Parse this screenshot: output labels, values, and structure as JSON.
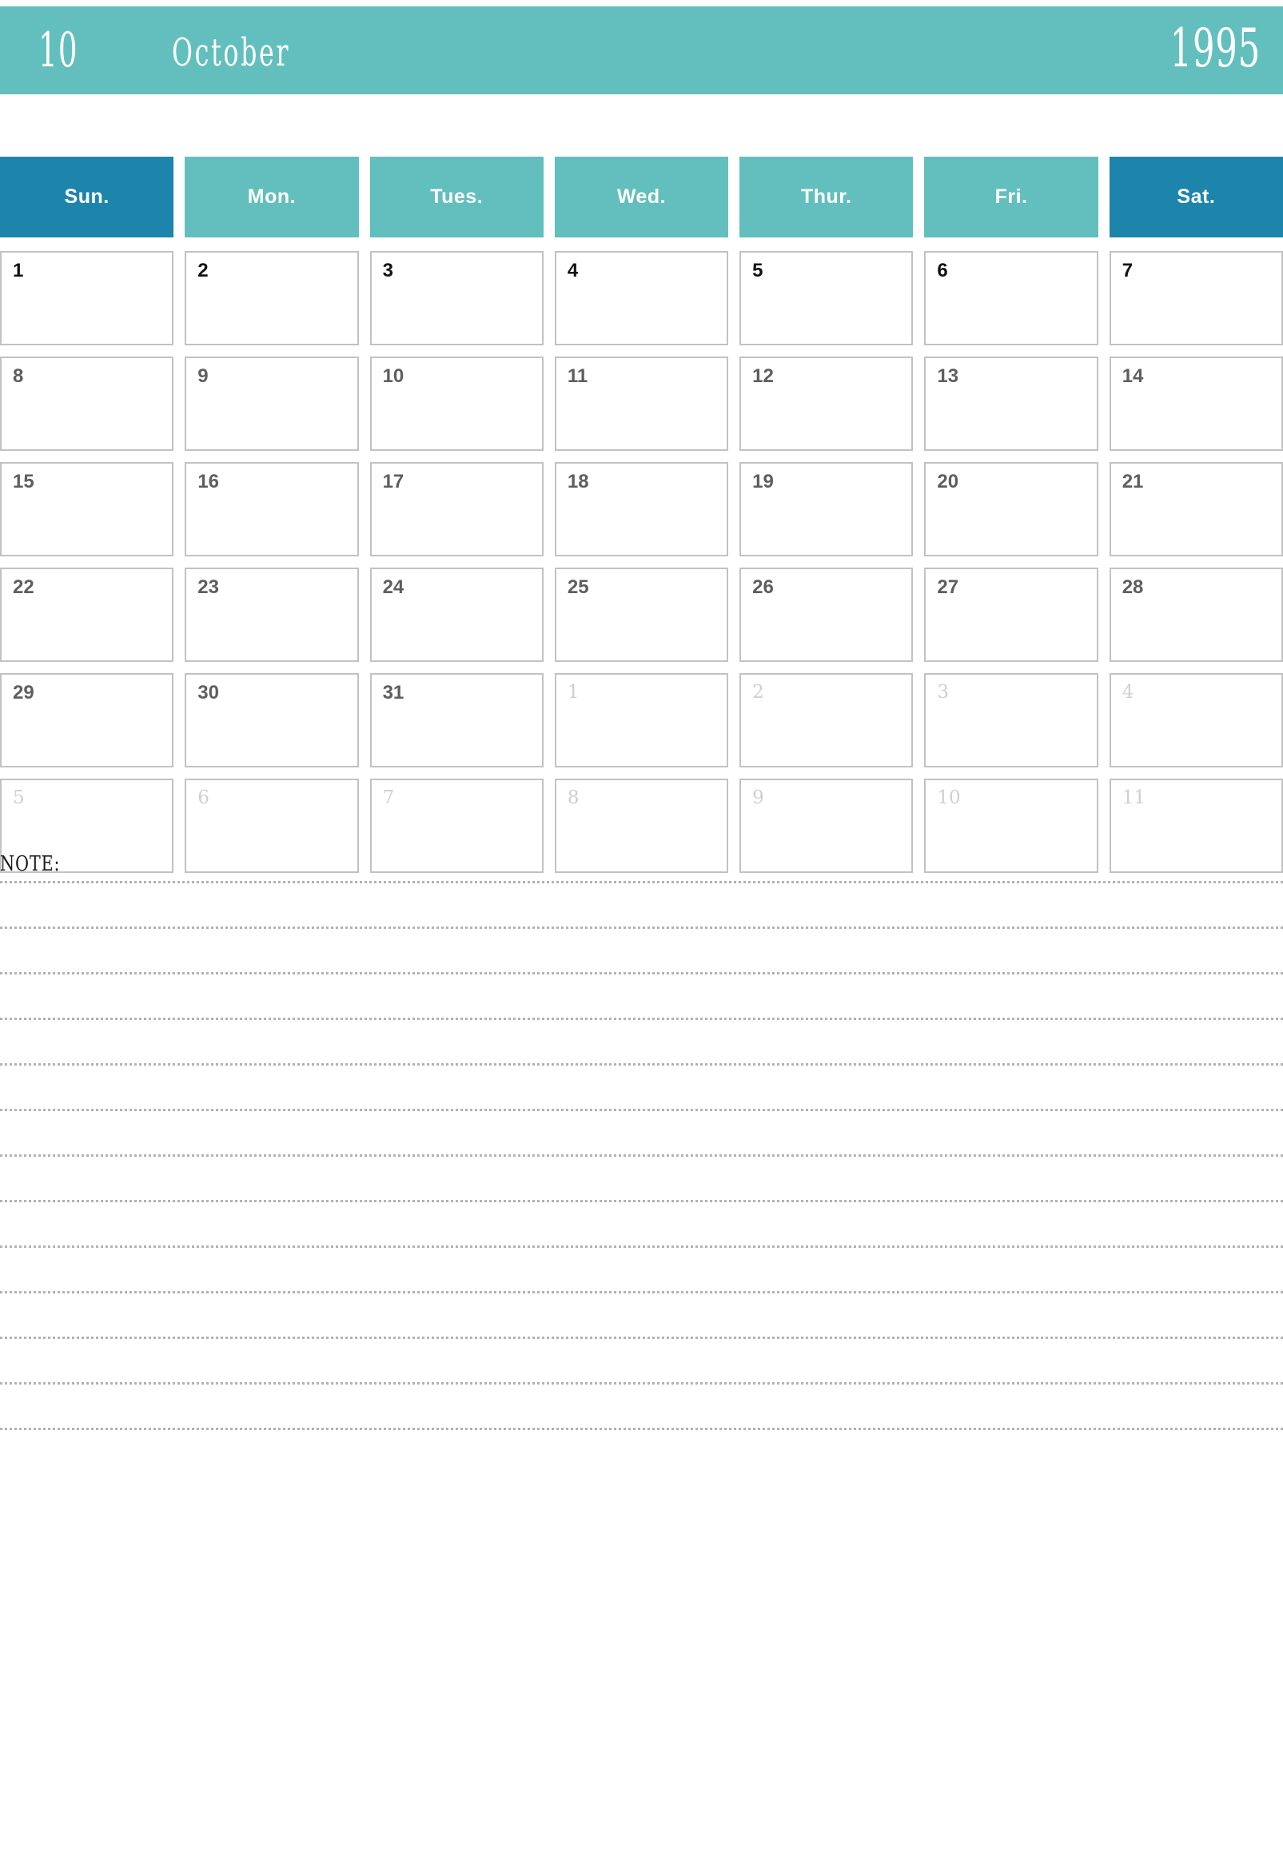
{
  "header": {
    "month_number": "10",
    "month_name": "October",
    "year": "1995",
    "banner_color": "#62bfbd",
    "weekend_color": "#1d85ab",
    "text_color": "#ffffff"
  },
  "weekdays": [
    {
      "label": "Sun.",
      "weekend": true
    },
    {
      "label": "Mon.",
      "weekend": false
    },
    {
      "label": "Tues.",
      "weekend": false
    },
    {
      "label": "Wed.",
      "weekend": false
    },
    {
      "label": "Thur.",
      "weekend": false
    },
    {
      "label": "Fri.",
      "weekend": false
    },
    {
      "label": "Sat.",
      "weekend": true
    }
  ],
  "weeks": [
    [
      {
        "day": "1",
        "other_month": false
      },
      {
        "day": "2",
        "other_month": false
      },
      {
        "day": "3",
        "other_month": false
      },
      {
        "day": "4",
        "other_month": false
      },
      {
        "day": "5",
        "other_month": false
      },
      {
        "day": "6",
        "other_month": false
      },
      {
        "day": "7",
        "other_month": false
      }
    ],
    [
      {
        "day": "8",
        "other_month": false
      },
      {
        "day": "9",
        "other_month": false
      },
      {
        "day": "10",
        "other_month": false
      },
      {
        "day": "11",
        "other_month": false
      },
      {
        "day": "12",
        "other_month": false
      },
      {
        "day": "13",
        "other_month": false
      },
      {
        "day": "14",
        "other_month": false
      }
    ],
    [
      {
        "day": "15",
        "other_month": false
      },
      {
        "day": "16",
        "other_month": false
      },
      {
        "day": "17",
        "other_month": false
      },
      {
        "day": "18",
        "other_month": false
      },
      {
        "day": "19",
        "other_month": false
      },
      {
        "day": "20",
        "other_month": false
      },
      {
        "day": "21",
        "other_month": false
      }
    ],
    [
      {
        "day": "22",
        "other_month": false
      },
      {
        "day": "23",
        "other_month": false
      },
      {
        "day": "24",
        "other_month": false
      },
      {
        "day": "25",
        "other_month": false
      },
      {
        "day": "26",
        "other_month": false
      },
      {
        "day": "27",
        "other_month": false
      },
      {
        "day": "28",
        "other_month": false
      }
    ],
    [
      {
        "day": "29",
        "other_month": false
      },
      {
        "day": "30",
        "other_month": false
      },
      {
        "day": "31",
        "other_month": false
      },
      {
        "day": "1",
        "other_month": true
      },
      {
        "day": "2",
        "other_month": true
      },
      {
        "day": "3",
        "other_month": true
      },
      {
        "day": "4",
        "other_month": true
      }
    ],
    [
      {
        "day": "5",
        "other_month": true
      },
      {
        "day": "6",
        "other_month": true
      },
      {
        "day": "7",
        "other_month": true
      },
      {
        "day": "8",
        "other_month": true
      },
      {
        "day": "9",
        "other_month": true
      },
      {
        "day": "10",
        "other_month": true
      },
      {
        "day": "11",
        "other_month": true
      }
    ]
  ],
  "note": {
    "label": "NOTE:",
    "line_count": 13
  }
}
